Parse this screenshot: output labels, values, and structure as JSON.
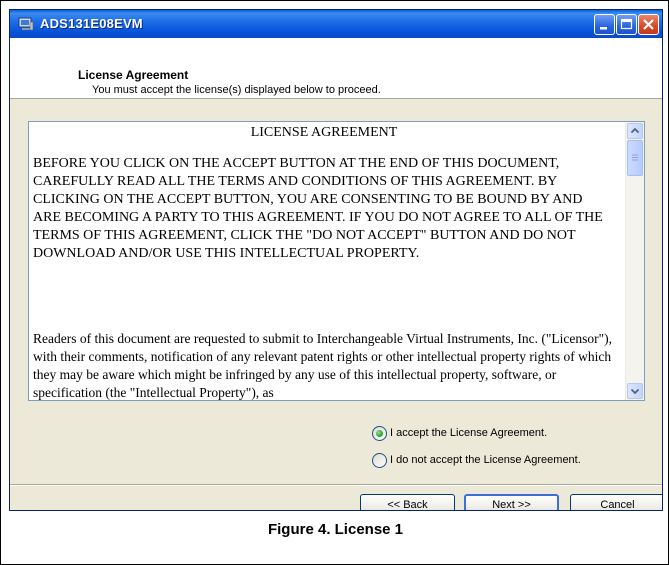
{
  "window": {
    "title": "ADS131E08EVM",
    "title_icon": "computer-icon"
  },
  "header": {
    "title": "License Agreement",
    "subtitle": "You must accept the license(s) displayed below to proceed."
  },
  "license": {
    "heading": "LICENSE AGREEMENT",
    "paragraph1": "BEFORE YOU CLICK ON THE ACCEPT BUTTON AT THE END OF THIS DOCUMENT, CAREFULLY READ ALL THE TERMS AND CONDITIONS OF THIS AGREEMENT. BY CLICKING ON THE ACCEPT BUTTON, YOU ARE CONSENTING TO BE BOUND BY AND ARE BECOMING A PARTY TO THIS AGREEMENT. IF YOU DO NOT AGREE TO ALL OF THE TERMS OF THIS AGREEMENT, CLICK THE \"DO NOT ACCEPT\" BUTTON AND DO NOT DOWNLOAD AND/OR USE THIS INTELLECTUAL PROPERTY.",
    "paragraph2": "Readers of this document are requested to submit to Interchangeable Virtual Instruments, Inc. (\"Licensor\"), with their comments, notification of any relevant patent rights or other intellectual property rights of which they may be aware which might be infringed by any use of this intellectual property, software, or specification (the \"Intellectual Property\"), as"
  },
  "options": {
    "accept_label": "I accept the License Agreement.",
    "decline_label": "I do not accept the License Agreement.",
    "selected": "accept"
  },
  "buttons": {
    "back": "<< Back",
    "next": "Next >>",
    "cancel": "Cancel"
  },
  "caption": "Figure 4. License 1",
  "colors": {
    "titlebar": "#0855dd",
    "dialog_bg": "#ece9d8",
    "close_button": "#d64a26",
    "radio_selected": "#21a121"
  }
}
